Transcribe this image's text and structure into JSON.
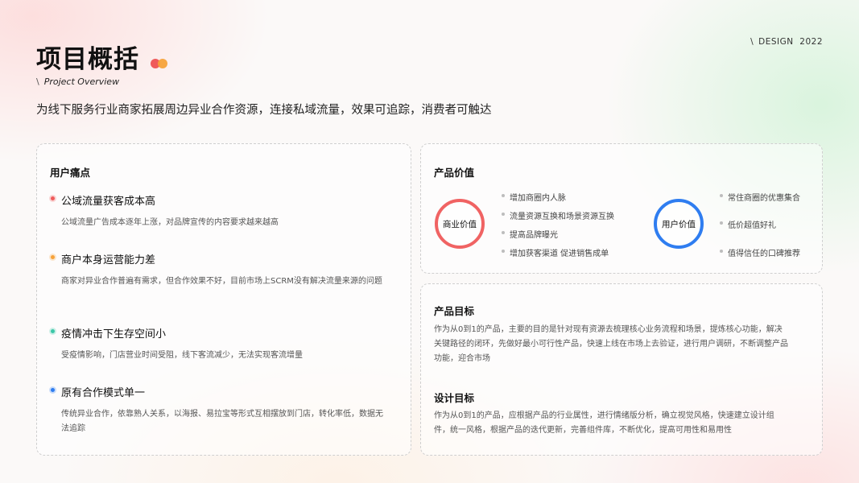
{
  "header": {
    "title": "项目概括",
    "subtitle_slash": "\\",
    "subtitle": "Project Overview",
    "tag_slash": "\\",
    "tag": "DESIGN  2022",
    "intro": "为线下服务行业商家拓展周边异业合作资源，连接私域流量，效果可追踪，消费者可触达"
  },
  "colors": {
    "red": "#ef5b5b",
    "orange": "#f7a23a",
    "teal": "#3cc7a8",
    "blue": "#2f7df0"
  },
  "pain_points": {
    "title": "用户痛点",
    "items": [
      {
        "title": "公域流量获客成本高",
        "desc": "公域流量广告成本逐年上涨，对品牌宣传的内容要求越来越高"
      },
      {
        "title": "商户本身运营能力差",
        "desc": "商家对异业合作普遍有需求，但合作效果不好，目前市场上SCRM没有解决流量来源的问题"
      },
      {
        "title": "疫情冲击下生存空间小",
        "desc": "受疫情影响，门店营业时间受阻，线下客流减少，无法实现客流增量"
      },
      {
        "title": "原有合作模式单一",
        "desc": "传统异业合作，依靠熟人关系，以海报、易拉宝等形式互相摆放到门店，转化率低，数据无法追踪"
      }
    ]
  },
  "product_value": {
    "title": "产品价值",
    "business": {
      "label": "商业价值",
      "items": [
        "增加商圈内人脉",
        "流量资源互换和场景资源互换",
        "提高品牌曝光",
        "增加获客渠道 促进销售成单"
      ]
    },
    "user": {
      "label": "用户价值",
      "items": [
        "常住商圈的优惠集合",
        "低价超值好礼",
        "值得信任的口碑推荐"
      ]
    }
  },
  "goals": {
    "product_title": "产品目标",
    "product_desc": "作为从0到1的产品，主要的目的是针对现有资源去梳理核心业务流程和场景，提炼核心功能，解决关键路径的闭环，先做好最小可行性产品，快速上线在市场上去验证，进行用户调研，不断调整产品功能，迎合市场",
    "design_title": "设计目标",
    "design_desc": "作为从0到1的产品，应根据产品的行业属性，进行情绪版分析，确立视觉风格，快速建立设计组件，统一风格，根据产品的迭代更新，完善组件库，不断优化，提高可用性和易用性"
  }
}
